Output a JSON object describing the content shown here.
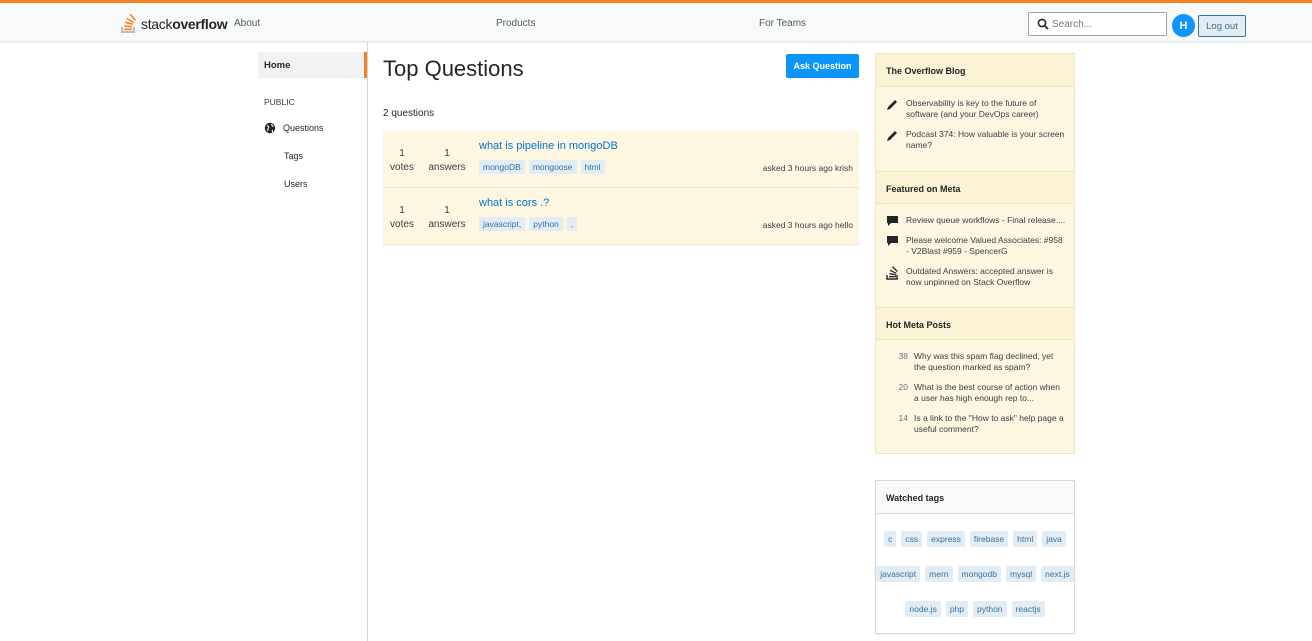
{
  "header": {
    "logo_prefix": "stack",
    "logo_bold": "overflow",
    "nav": [
      "About",
      "Products",
      "For Teams"
    ],
    "search_placeholder": "Search...",
    "avatar_letter": "H",
    "logout_label": "Log out",
    "accent_color": "#f48225"
  },
  "sidebar": {
    "home": "Home",
    "public": "PUBLIC",
    "questions": "Questions",
    "tags": "Tags",
    "users": "Users"
  },
  "main": {
    "title": "Top Questions",
    "ask_button": "Ask Question",
    "count_label": "2 questions",
    "questions": [
      {
        "votes": "1",
        "votes_label": "votes",
        "answers": "1",
        "answers_label": "answers",
        "title": "what is pipeline in mongoDB",
        "tags": [
          "mongoDB",
          "mongoose",
          "html"
        ],
        "asked": "asked 3 hours ago krish"
      },
      {
        "votes": "1",
        "votes_label": "votes",
        "answers": "1",
        "answers_label": "answers",
        "title": "what is cors .?",
        "tags": [
          "javascript,",
          "python",
          ","
        ],
        "asked": "asked 3 hours ago hello"
      }
    ]
  },
  "right": {
    "blog": {
      "title": "The Overflow Blog",
      "items": [
        "Observability is key to the future of software (and your DevOps career)",
        "Podcast 374: How valuable is your screen name?"
      ]
    },
    "meta": {
      "title": "Featured on Meta",
      "items": [
        "Review queue workflows - Final release....",
        "Please welcome Valued Associates: #958 - V2Blast #959 - SpencerG",
        "Outdated Answers: accepted answer is now unpinned on Stack Overflow"
      ]
    },
    "hot": {
      "title": "Hot Meta Posts",
      "items": [
        {
          "count": "38",
          "text": "Why was this spam flag declined, yet the question marked as spam?"
        },
        {
          "count": "20",
          "text": "What is the best course of action when a user has high enough rep to..."
        },
        {
          "count": "14",
          "text": "Is a link to the \"How to ask\" help page a useful comment?"
        }
      ]
    },
    "watched": {
      "title": "Watched tags",
      "rows": [
        [
          "c",
          "css",
          "express",
          "firebase",
          "html",
          "java"
        ],
        [
          "javascript",
          "mern",
          "mongodb",
          "mysql",
          "next.js"
        ],
        [
          "node.js",
          "php",
          "python",
          "reactjs"
        ]
      ]
    }
  }
}
